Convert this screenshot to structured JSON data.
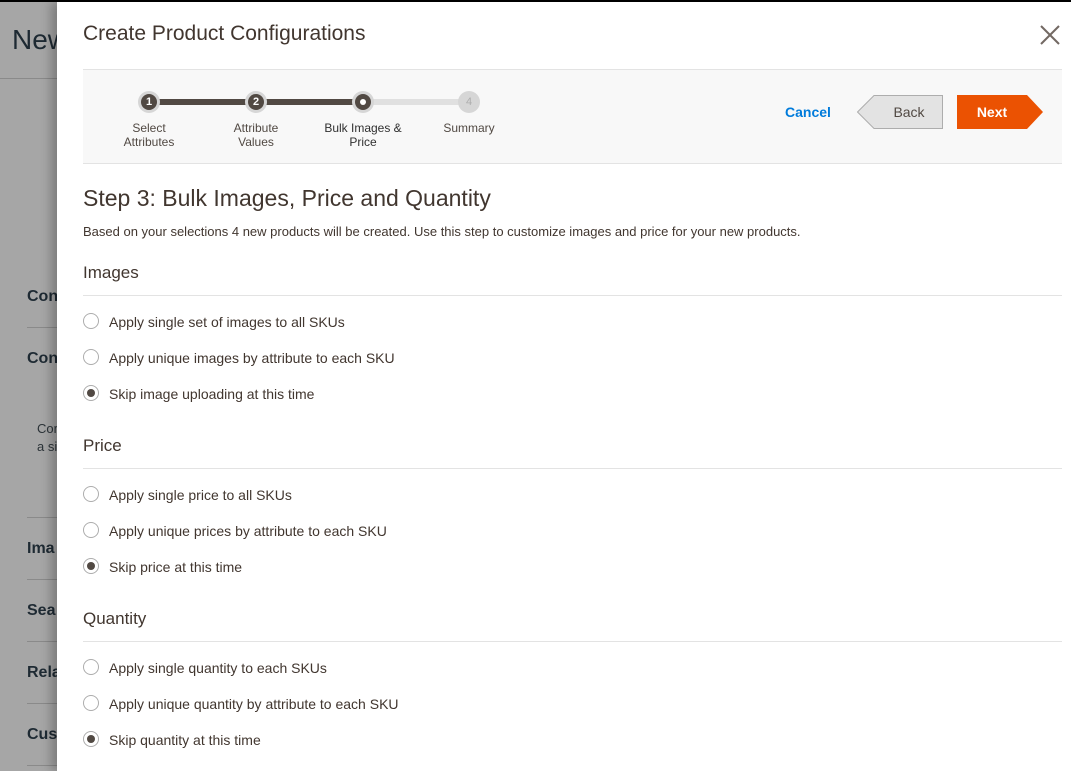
{
  "background_page": {
    "title": "New",
    "sections": [
      "Con",
      "Con",
      "Ima",
      "Sea",
      "Rela",
      "Cus"
    ],
    "note_lines": [
      "Cor",
      "a si"
    ]
  },
  "modal": {
    "title": "Create Product Configurations",
    "close_icon": "close-x-icon"
  },
  "wizard": {
    "steps": [
      {
        "number": "1",
        "label_line1": "Select",
        "label_line2": "Attributes",
        "state": "done"
      },
      {
        "number": "2",
        "label_line1": "Attribute",
        "label_line2": "Values",
        "state": "done"
      },
      {
        "number": "",
        "label_line1": "Bulk Images &",
        "label_line2": "Price",
        "state": "current"
      },
      {
        "number": "4",
        "label_line1": "Summary",
        "label_line2": "",
        "state": "todo"
      }
    ],
    "cancel_label": "Cancel",
    "back_label": "Back",
    "next_label": "Next",
    "colors": {
      "next": "#eb5202",
      "progress": "#514943",
      "link": "#007bdb"
    }
  },
  "content": {
    "heading": "Step 3: Bulk Images, Price and Quantity",
    "description": "Based on your selections 4 new products will be created. Use this step to customize images and price for your new products.",
    "sections": [
      {
        "title": "Images",
        "options": [
          {
            "label": "Apply single set of images to all SKUs",
            "checked": false
          },
          {
            "label": "Apply unique images by attribute to each SKU",
            "checked": false
          },
          {
            "label": "Skip image uploading at this time",
            "checked": true
          }
        ]
      },
      {
        "title": "Price",
        "options": [
          {
            "label": "Apply single price to all SKUs",
            "checked": false
          },
          {
            "label": "Apply unique prices by attribute to each SKU",
            "checked": false
          },
          {
            "label": "Skip price at this time",
            "checked": true
          }
        ]
      },
      {
        "title": "Quantity",
        "options": [
          {
            "label": "Apply single quantity to each SKUs",
            "checked": false
          },
          {
            "label": "Apply unique quantity by attribute to each SKU",
            "checked": false
          },
          {
            "label": "Skip quantity at this time",
            "checked": true
          }
        ]
      }
    ]
  }
}
